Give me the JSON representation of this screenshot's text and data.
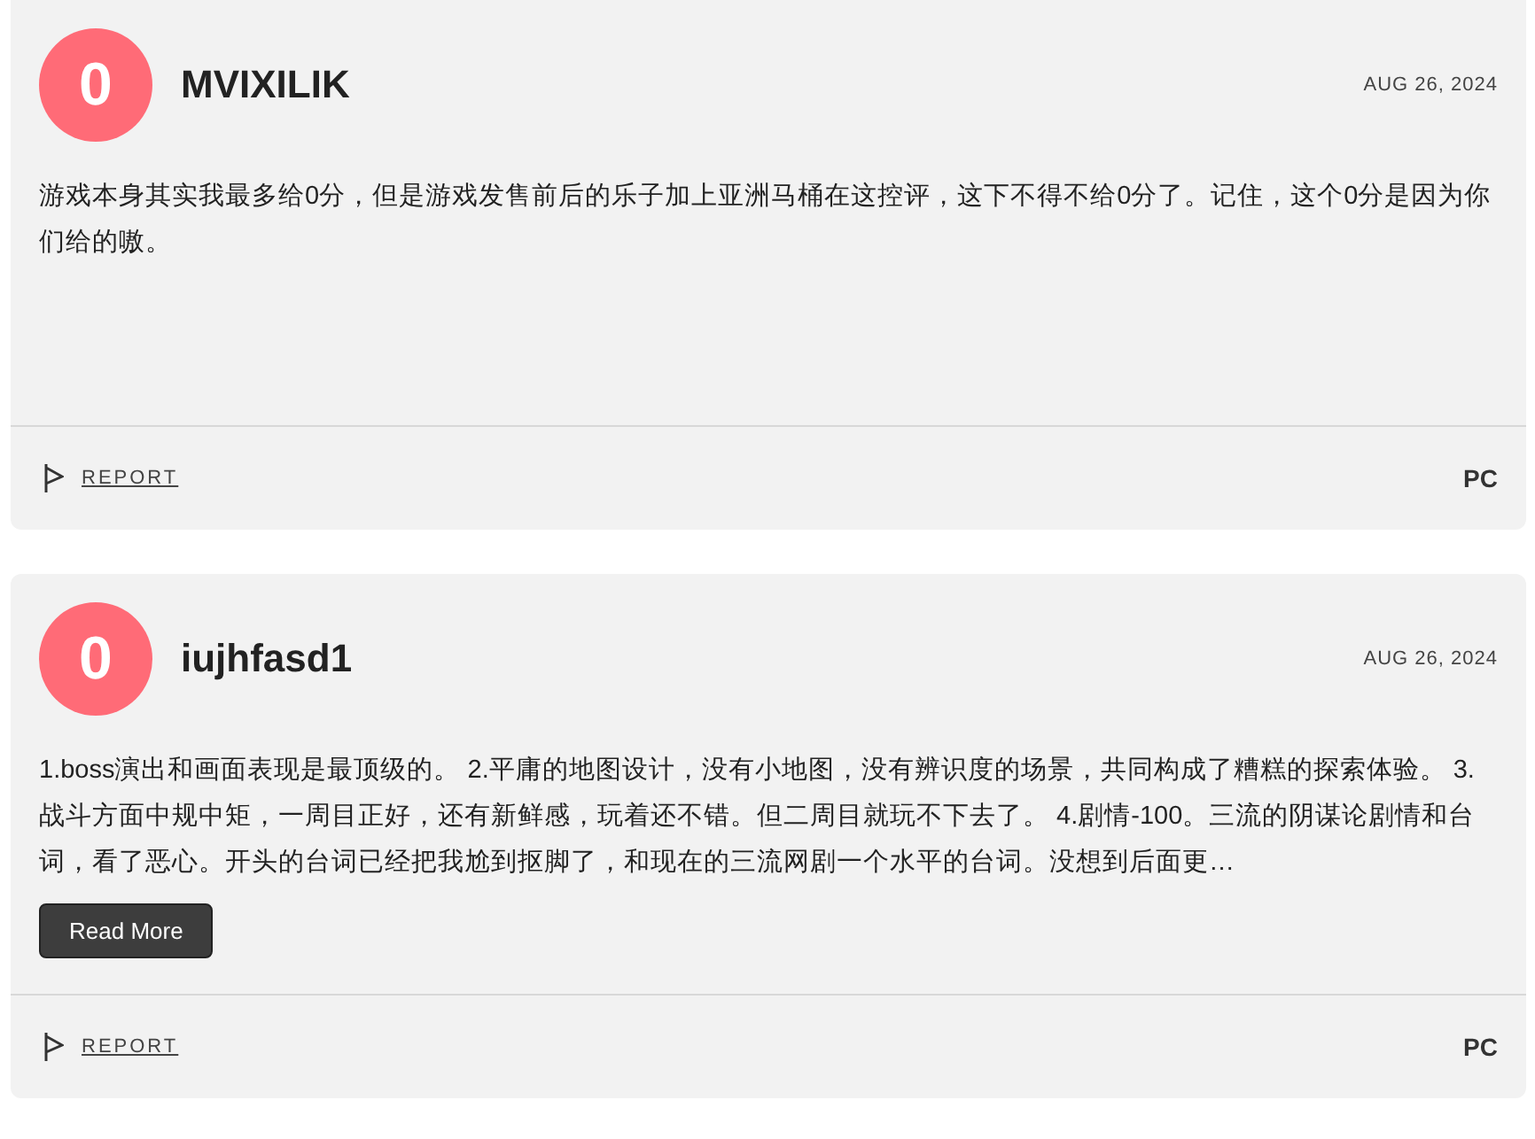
{
  "reviews": [
    {
      "avatar": "0",
      "name": "MVIXILIK",
      "date": "AUG 26, 2024",
      "text": "游戏本身其实我最多给0分，但是游戏发售前后的乐子加上亚洲马桶在这控评，这下不得不给0分了。记住，这个0分是因为你们给的嗷。",
      "report": "REPORT",
      "platform": "PC"
    },
    {
      "avatar": "0",
      "name": "iujhfasd1",
      "date": "AUG 26, 2024",
      "text": "1.boss演出和画面表现是最顶级的。 2.平庸的地图设计，没有小地图，没有辨识度的场景，共同构成了糟糕的探索体验。 3.战斗方面中规中矩，一周目正好，还有新鲜感，玩着还不错。但二周目就玩不下去了。 4.剧情-100。三流的阴谋论剧情和台词，看了恶心。开头的台词已经把我尬到抠脚了，和现在的三流网剧一个水平的台词。没想到后面更…",
      "read_more": "Read More",
      "report": "REPORT",
      "platform": "PC"
    }
  ]
}
